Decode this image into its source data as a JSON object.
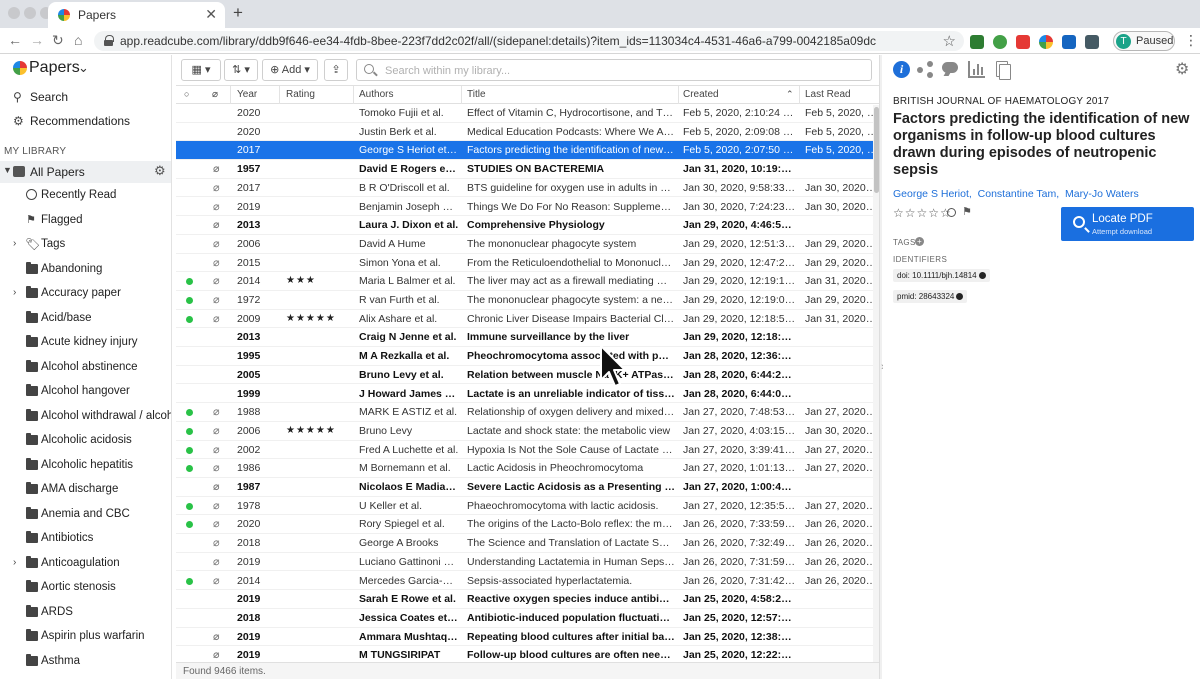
{
  "browser": {
    "tab_title": "Papers",
    "tab_close": "✕",
    "new_tab": "+",
    "url": "app.readcube.com/library/ddb9f646-ee34-4fdb-8bee-223f7dd2c02f/all/(sidepanel:details)?item_ids=113034c4-4531-46a6-a799-0042185a09dc",
    "profile_initial": "T",
    "profile_label": "Paused",
    "nav": {
      "back": "←",
      "forward": "→",
      "reload": "↻",
      "home": "⌂"
    },
    "ext_colors": [
      "#2e7d32",
      "#43a047",
      "#e53935",
      "#fb8c00",
      "#1565c0",
      "#6a1b9a",
      "#455a64"
    ]
  },
  "sidebar": {
    "app_name": "Papers",
    "links": [
      {
        "icon": "search-icon",
        "label": "Search"
      },
      {
        "icon": "gear-icon",
        "label": "Recommendations"
      }
    ],
    "section_label": "MY LIBRARY",
    "all_papers_label": "All Papers",
    "items": [
      {
        "label": "Recently Read",
        "icon": "clock-icon",
        "expandable": false
      },
      {
        "label": "Flagged",
        "icon": "flag-icon",
        "expandable": false
      },
      {
        "label": "Tags",
        "icon": "tag-icon",
        "expandable": true
      },
      {
        "label": "Abandoning",
        "icon": "folder-icon",
        "expandable": false
      },
      {
        "label": "Accuracy paper",
        "icon": "folder-icon",
        "expandable": true
      },
      {
        "label": "Acid/base",
        "icon": "folder-icon",
        "expandable": false
      },
      {
        "label": "Acute kidney injury",
        "icon": "folder-icon",
        "expandable": false
      },
      {
        "label": "Alcohol abstinence",
        "icon": "folder-icon",
        "expandable": false
      },
      {
        "label": "Alcohol hangover",
        "icon": "folder-icon",
        "expandable": false
      },
      {
        "label": "Alcohol withdrawal / alcohol",
        "icon": "folder-icon",
        "expandable": false
      },
      {
        "label": "Alcoholic acidosis",
        "icon": "folder-icon",
        "expandable": false
      },
      {
        "label": "Alcoholic hepatitis",
        "icon": "folder-icon",
        "expandable": false
      },
      {
        "label": "AMA discharge",
        "icon": "folder-icon",
        "expandable": false
      },
      {
        "label": "Anemia and CBC",
        "icon": "folder-icon",
        "expandable": false
      },
      {
        "label": "Antibiotics",
        "icon": "folder-icon",
        "expandable": false
      },
      {
        "label": "Anticoagulation",
        "icon": "folder-icon",
        "expandable": true
      },
      {
        "label": "Aortic stenosis",
        "icon": "folder-icon",
        "expandable": false
      },
      {
        "label": "ARDS",
        "icon": "folder-icon",
        "expandable": false
      },
      {
        "label": "Aspirin plus warfarin",
        "icon": "folder-icon",
        "expandable": false
      },
      {
        "label": "Asthma",
        "icon": "folder-icon",
        "expandable": false
      }
    ]
  },
  "toolbar": {
    "add_label": "Add",
    "search_placeholder": "Search within my library..."
  },
  "table": {
    "headers": {
      "year": "Year",
      "rating": "Rating",
      "authors": "Authors",
      "title": "Title",
      "created": "Created",
      "last_read": "Last Read"
    },
    "rows": [
      {
        "dot": false,
        "clip": false,
        "year": "2020",
        "rating": "",
        "authors": "Tomoko Fujii et al.",
        "title": "Effect of Vitamin C, Hydrocortisone, and Thiamine vs H...",
        "created": "Feb 5, 2020, 2:10:24 PM",
        "last_read": "Feb 5, 2020, 2:11:3",
        "bold": false,
        "selected": false
      },
      {
        "dot": false,
        "clip": false,
        "year": "2020",
        "rating": "",
        "authors": "Justin Berk et al.",
        "title": "Medical Education Podcasts: Where We Are and Questi...",
        "created": "Feb 5, 2020, 2:09:08 PM",
        "last_read": "Feb 5, 2020, 2:11:1",
        "bold": false,
        "selected": false
      },
      {
        "dot": false,
        "clip": false,
        "year": "2017",
        "rating": "",
        "authors": "George S Heriot et al.",
        "title": "Factors predicting the identification of new organisms i...",
        "created": "Feb 5, 2020, 2:07:50 PM",
        "last_read": "Feb 5, 2020, 2:10:1",
        "bold": false,
        "selected": true
      },
      {
        "dot": false,
        "clip": true,
        "year": "1957",
        "rating": "",
        "authors": "David E Rogers et al.",
        "title": "STUDIES ON BACTEREMIA",
        "created": "Jan 31, 2020, 10:19:29 AM",
        "last_read": "",
        "bold": true,
        "selected": false
      },
      {
        "dot": false,
        "clip": true,
        "year": "2017",
        "rating": "",
        "authors": "B R O'Driscoll et al.",
        "title": "BTS guideline for oxygen use in adults in healthcare and...",
        "created": "Jan 30, 2020, 9:58:33 AM",
        "last_read": "Jan 30, 2020, 10:0",
        "bold": false,
        "selected": false
      },
      {
        "dot": false,
        "clip": true,
        "year": "2019",
        "rating": "",
        "authors": "Benjamin Joseph Moss ...",
        "title": "Things We Do For No Reason: Supplemental Oxygen for...",
        "created": "Jan 30, 2020, 7:24:23 AM",
        "last_read": "Jan 30, 2020, 8:19",
        "bold": false,
        "selected": false
      },
      {
        "dot": false,
        "clip": true,
        "year": "2013",
        "rating": "",
        "authors": "Laura J. Dixon et al.",
        "title": "Comprehensive Physiology",
        "created": "Jan 29, 2020, 4:46:56 PM",
        "last_read": "",
        "bold": true,
        "selected": false
      },
      {
        "dot": false,
        "clip": true,
        "year": "2006",
        "rating": "",
        "authors": "David A Hume",
        "title": "The mononuclear phagocyte system",
        "created": "Jan 29, 2020, 12:51:38 PM",
        "last_read": "Jan 29, 2020, 12:5",
        "bold": false,
        "selected": false
      },
      {
        "dot": false,
        "clip": true,
        "year": "2015",
        "rating": "",
        "authors": "Simon Yona et al.",
        "title": "From the Reticuloendothelial to Mononuclear Phagocyt...",
        "created": "Jan 29, 2020, 12:47:24 PM",
        "last_read": "Jan 29, 2020, 12:5",
        "bold": false,
        "selected": false
      },
      {
        "dot": true,
        "clip": true,
        "year": "2014",
        "rating": "★★★",
        "authors": "Maria L Balmer et al.",
        "title": "The liver may act as a firewall mediating mutualism bet...",
        "created": "Jan 29, 2020, 12:19:12 PM",
        "last_read": "Jan 31, 2020, 9:02",
        "bold": false,
        "selected": false
      },
      {
        "dot": true,
        "clip": true,
        "year": "1972",
        "rating": "",
        "authors": "R van Furth et al.",
        "title": "The mononuclear phagocyte system: a new classificatio...",
        "created": "Jan 29, 2020, 12:19:00 PM",
        "last_read": "Jan 29, 2020, 12:2",
        "bold": false,
        "selected": false
      },
      {
        "dot": true,
        "clip": true,
        "year": "2009",
        "rating": "★★★★★",
        "authors": "Alix Ashare et al.",
        "title": "Chronic Liver Disease Impairs Bacterial Clearance in a H...",
        "created": "Jan 29, 2020, 12:18:54 PM",
        "last_read": "Jan 31, 2020, 3:43",
        "bold": false,
        "selected": false
      },
      {
        "dot": false,
        "clip": false,
        "year": "2013",
        "rating": "",
        "authors": "Craig N Jenne et al.",
        "title": "Immune surveillance by the liver",
        "created": "Jan 29, 2020, 12:18:51 PM",
        "last_read": "",
        "bold": true,
        "selected": false
      },
      {
        "dot": false,
        "clip": false,
        "year": "1995",
        "rating": "",
        "authors": "M A Rezkalla et al.",
        "title": "Pheochromocytoma associated with polycythemia...",
        "created": "Jan 28, 2020, 12:36:24 PM",
        "last_read": "",
        "bold": true,
        "selected": false
      },
      {
        "dot": false,
        "clip": false,
        "year": "2005",
        "rating": "",
        "authors": "Bruno Levy et al.",
        "title": "Relation between muscle Na+K+ ATPase activity...",
        "created": "Jan 28, 2020, 6:44:27 AM",
        "last_read": "",
        "bold": true,
        "selected": false
      },
      {
        "dot": false,
        "clip": false,
        "year": "1999",
        "rating": "",
        "authors": "J Howard James et al.",
        "title": "Lactate is an unreliable indicator of tissue hypoxia...",
        "created": "Jan 28, 2020, 6:44:09 AM",
        "last_read": "",
        "bold": true,
        "selected": false
      },
      {
        "dot": true,
        "clip": true,
        "year": "1988",
        "rating": "",
        "authors": "MARK E ASTIZ et al.",
        "title": "Relationship of oxygen delivery and mixed venous oxy...",
        "created": "Jan 27, 2020, 7:48:53 PM",
        "last_read": "Jan 27, 2020, 7:49",
        "bold": false,
        "selected": false
      },
      {
        "dot": true,
        "clip": true,
        "year": "2006",
        "rating": "★★★★★",
        "authors": "Bruno Levy",
        "title": "Lactate and shock state: the metabolic view",
        "created": "Jan 27, 2020, 4:03:15 PM",
        "last_read": "Jan 30, 2020, 9:15",
        "bold": false,
        "selected": false
      },
      {
        "dot": true,
        "clip": true,
        "year": "2002",
        "rating": "",
        "authors": "Fred A Luchette et al.",
        "title": "Hypoxia Is Not the Sole Cause of Lactate Production Du...",
        "created": "Jan 27, 2020, 3:39:41 PM",
        "last_read": "Jan 27, 2020, 3:39",
        "bold": false,
        "selected": false
      },
      {
        "dot": true,
        "clip": true,
        "year": "1986",
        "rating": "",
        "authors": "M Bornemann et al.",
        "title": "Lactic Acidosis in Pheochromocytoma",
        "created": "Jan 27, 2020, 1:01:13 PM",
        "last_read": "Jan 27, 2020, 3:45",
        "bold": false,
        "selected": false
      },
      {
        "dot": false,
        "clip": true,
        "year": "1987",
        "rating": "",
        "authors": "Nicolaos E Madias et al.",
        "title": "Severe Lactic Acidosis as a Presenting Feature of...",
        "created": "Jan 27, 2020, 1:00:40 PM",
        "last_read": "",
        "bold": true,
        "selected": false
      },
      {
        "dot": true,
        "clip": true,
        "year": "1978",
        "rating": "",
        "authors": "U Keller et al.",
        "title": "Phaeochromocytoma with lactic acidosis.",
        "created": "Jan 27, 2020, 12:35:52 PM",
        "last_read": "Jan 27, 2020, 3:48",
        "bold": false,
        "selected": false
      },
      {
        "dot": true,
        "clip": true,
        "year": "2020",
        "rating": "",
        "authors": "Rory Spiegel et al.",
        "title": "The origins of the Lacto-Bolo reflex: the mythology of la...",
        "created": "Jan 26, 2020, 7:33:59 PM",
        "last_read": "Jan 26, 2020, 5:38",
        "bold": false,
        "selected": false
      },
      {
        "dot": false,
        "clip": true,
        "year": "2018",
        "rating": "",
        "authors": "George A Brooks",
        "title": "The Science and Translation of Lactate Shuttle Theory",
        "created": "Jan 26, 2020, 7:32:49 PM",
        "last_read": "Jan 26, 2020, 5:37",
        "bold": false,
        "selected": false
      },
      {
        "dot": false,
        "clip": true,
        "year": "2019",
        "rating": "",
        "authors": "Luciano Gattinoni et al.",
        "title": "Understanding Lactatemia in Human Sepsis. Potential I...",
        "created": "Jan 26, 2020, 7:31:59 PM",
        "last_read": "Jan 26, 2020, 5:38",
        "bold": false,
        "selected": false
      },
      {
        "dot": true,
        "clip": true,
        "year": "2014",
        "rating": "",
        "authors": "Mercedes Garcia-Alvare...",
        "title": "Sepsis-associated hyperlactatemia.",
        "created": "Jan 26, 2020, 7:31:42 PM",
        "last_read": "Jan 26, 2020, 5:36",
        "bold": false,
        "selected": false
      },
      {
        "dot": false,
        "clip": false,
        "year": "2019",
        "rating": "",
        "authors": "Sarah E Rowe et al.",
        "title": "Reactive oxygen species induce antibiotic tolerance...",
        "created": "Jan 25, 2020, 4:58:28 PM",
        "last_read": "",
        "bold": true,
        "selected": false
      },
      {
        "dot": false,
        "clip": false,
        "year": "2018",
        "rating": "",
        "authors": "Jessica Coates et al.",
        "title": "Antibiotic-induced population fluctuations and stress...",
        "created": "Jan 25, 2020, 12:57:09 PM",
        "last_read": "",
        "bold": true,
        "selected": false
      },
      {
        "dot": false,
        "clip": true,
        "year": "2019",
        "rating": "",
        "authors": "Ammara Mushtaq et al.",
        "title": "Repeating blood cultures after initial bacteremia:...",
        "created": "Jan 25, 2020, 12:38:33 PM",
        "last_read": "",
        "bold": true,
        "selected": false
      },
      {
        "dot": false,
        "clip": true,
        "year": "2019",
        "rating": "",
        "authors": "M TUNGSIRIPAT",
        "title": "Follow-up blood cultures are often needed after...",
        "created": "Jan 25, 2020, 12:22:28 PM",
        "last_read": "",
        "bold": true,
        "selected": false
      }
    ]
  },
  "footer": {
    "count_text": "Found 9466 items."
  },
  "detail": {
    "journal": "BRITISH JOURNAL OF HAEMATOLOGY 2017",
    "title": "Factors predicting the identification of new organisms in follow-up blood cultures drawn during episodes of neutropenic sepsis",
    "authors": [
      "George S Heriot,",
      "Constantine Tam,",
      "Mary-Jo Waters"
    ],
    "rating_stars": "☆☆☆☆☆",
    "locate_label": "Locate PDF",
    "locate_sub": "Attempt download",
    "tags_label": "TAGS",
    "identifiers_label": "IDENTIFIERS",
    "doi": "doi: 10.1111/bjh.14814",
    "pmid": "pmid: 28643324"
  },
  "colors": {
    "accent": "#1a73e8",
    "unread_dot": "#29c247",
    "link": "#1e6fd9"
  }
}
